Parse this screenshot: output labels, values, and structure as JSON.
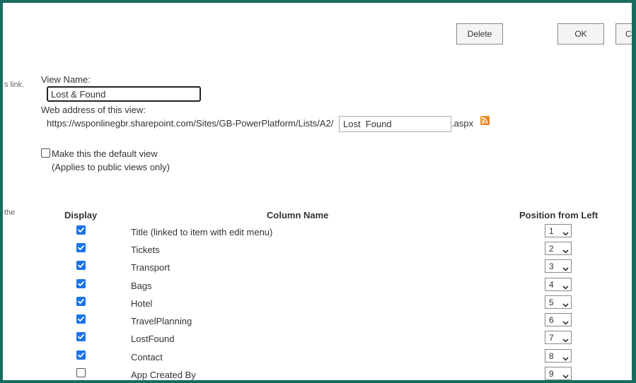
{
  "toolbar": {
    "delete_label": "Delete",
    "ok_label": "OK",
    "cancel_label": "Ca"
  },
  "side_texts": [
    "s link.",
    "the"
  ],
  "view_name": {
    "label": "View Name:",
    "value": "Lost & Found"
  },
  "web_address": {
    "label": "Web address of this view:",
    "prefix": "https://wsponlinegbr.sharepoint.com/Sites/GB-PowerPlatform/Lists/A2/",
    "value": "Lost  Found",
    "suffix": ".aspx",
    "rss_icon": "rss-feed-icon"
  },
  "default_view": {
    "checked": false,
    "label": "Make this the default view",
    "note": "(Applies to public views only)"
  },
  "columns_table": {
    "headers": {
      "display": "Display",
      "column_name": "Column Name",
      "position": "Position from Left"
    },
    "rows": [
      {
        "display": true,
        "name": "Title (linked to item with edit menu)",
        "position": "1"
      },
      {
        "display": true,
        "name": "Tickets",
        "position": "2"
      },
      {
        "display": true,
        "name": "Transport",
        "position": "3"
      },
      {
        "display": true,
        "name": "Bags",
        "position": "4"
      },
      {
        "display": true,
        "name": "Hotel",
        "position": "5"
      },
      {
        "display": true,
        "name": "TravelPlanning",
        "position": "6"
      },
      {
        "display": true,
        "name": "LostFound",
        "position": "7"
      },
      {
        "display": true,
        "name": "Contact",
        "position": "8"
      },
      {
        "display": false,
        "name": "App Created By",
        "position": "9"
      }
    ]
  },
  "colors": {
    "frame": "#1a6b5f",
    "checkbox_checked": "#1a73e8",
    "rss": "#f39c12"
  }
}
